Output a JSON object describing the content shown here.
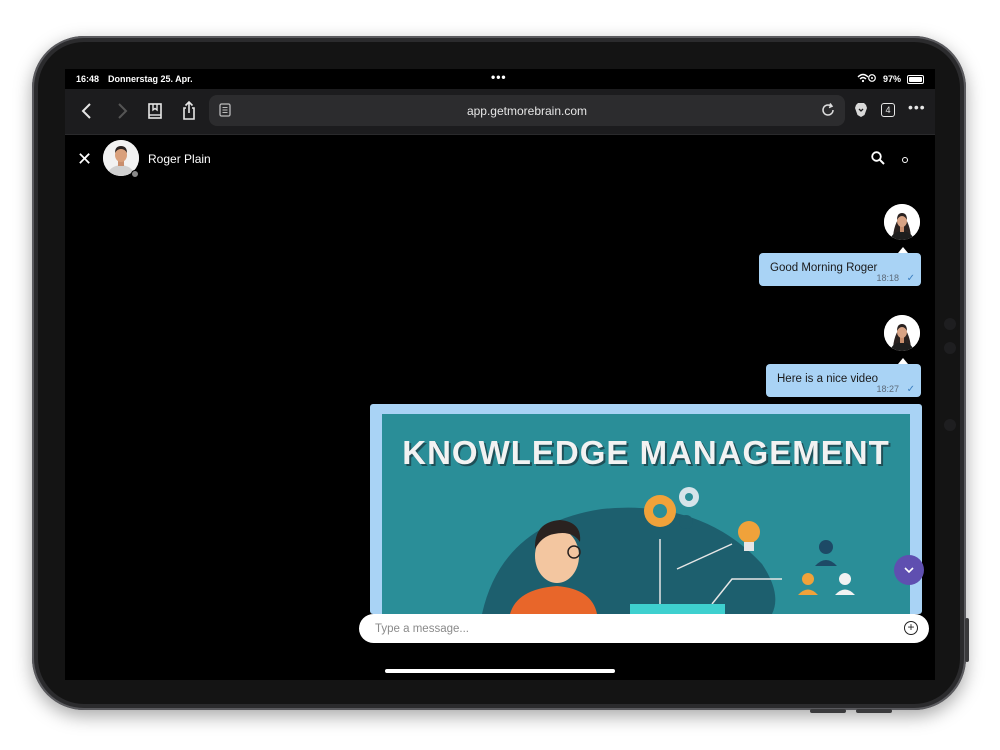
{
  "status_bar": {
    "time": "16:48",
    "date": "Donnerstag 25. Apr.",
    "battery_percent": "97%",
    "battery_level": 0.97
  },
  "browser": {
    "url": "app.getmorebrain.com",
    "tab_count": "4"
  },
  "chat": {
    "contact_name": "Roger Plain",
    "messages": [
      {
        "text": "Good Morning Roger",
        "time": "18:18"
      },
      {
        "text": "Here is a nice video",
        "time": "18:27"
      }
    ],
    "video": {
      "title": "KNOWLEDGE MANAGEMENT"
    },
    "input_placeholder": "Type a message..."
  },
  "colors": {
    "bubble": "#a9d3f5",
    "video_bg": "#2a8e98",
    "scroll_button": "#5f4fb0"
  }
}
